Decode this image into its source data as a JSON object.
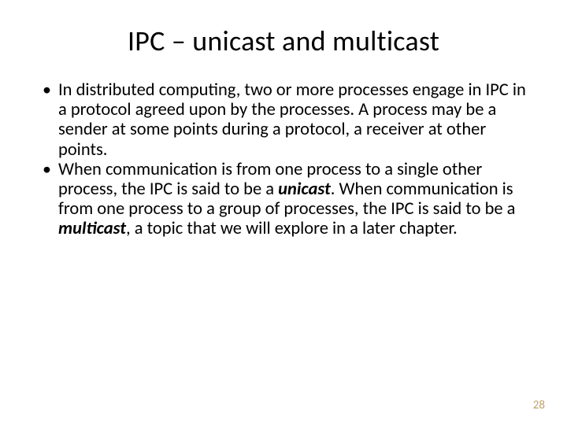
{
  "title": "IPC – unicast and multicast",
  "bullets": [
    {
      "text": "In distributed computing, two or more processes engage in IPC in a protocol agreed upon by the processes.  A process may be a sender at some points during a protocol, a receiver at other points."
    },
    {
      "pre": "When communication is from one process to a single other process, the IPC is said to be a ",
      "em1": "unicast",
      "mid": ".  When communication is from one process to a group of processes, the IPC is said to be a ",
      "em2": "multicast",
      "post": ", a topic that we will explore in a later chapter."
    }
  ],
  "page_number": "28"
}
